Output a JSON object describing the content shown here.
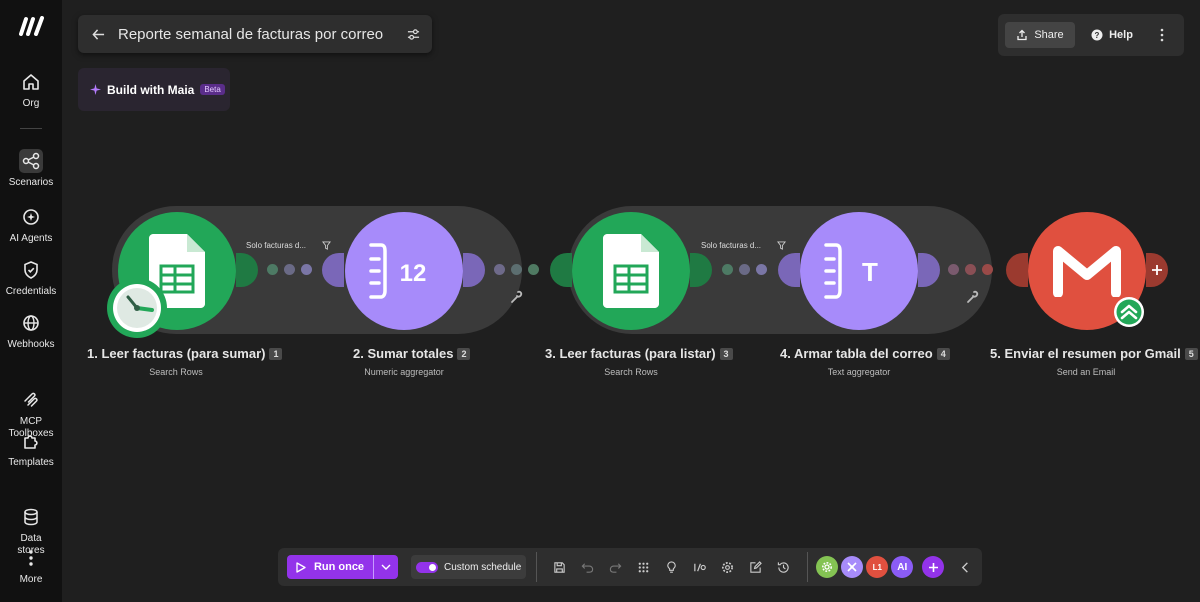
{
  "sidebar": {
    "items": [
      {
        "label": "Org",
        "icon": "home-icon"
      },
      {
        "label": "Scenarios",
        "icon": "scenarios-icon"
      },
      {
        "label": "AI Agents",
        "icon": "ai-agents-icon"
      },
      {
        "label": "Credentials",
        "icon": "shield-icon"
      },
      {
        "label": "Webhooks",
        "icon": "globe-icon"
      },
      {
        "label": "MCP\nToolboxes",
        "icon": "mcp-icon"
      },
      {
        "label": "Templates",
        "icon": "puzzle-icon"
      },
      {
        "label": "Data\nstores",
        "icon": "database-icon"
      },
      {
        "label": "More",
        "icon": "more-vertical-icon"
      }
    ]
  },
  "header": {
    "title": "Reporte semanal de facturas por correo",
    "share_label": "Share",
    "help_label": "Help"
  },
  "maia": {
    "label": "Build with Maia",
    "badge": "Beta"
  },
  "scenario": {
    "filters": [
      "Solo facturas d...",
      "Solo facturas d..."
    ],
    "modules": [
      {
        "label": "1. Leer facturas (para sumar)",
        "number": "1",
        "subtitle": "Search Rows"
      },
      {
        "label": "2. Sumar totales",
        "number": "2",
        "subtitle": "Numeric aggregator"
      },
      {
        "label": "3. Leer facturas (para listar)",
        "number": "3",
        "subtitle": "Search Rows"
      },
      {
        "label": "4. Armar tabla del correo",
        "number": "4",
        "subtitle": "Text aggregator"
      },
      {
        "label": "5. Enviar el resumen por Gmail",
        "number": "5",
        "subtitle": "Send an Email"
      }
    ],
    "icon_texts": {
      "numeric": "12",
      "text": "T"
    }
  },
  "toolbar": {
    "run_label": "Run once",
    "schedule_label": "Custom schedule",
    "badges": [
      "",
      "",
      "L1",
      "AI"
    ]
  },
  "colors": {
    "sheets_green": "#22a758",
    "aggregator_purple": "#a78bfa",
    "gmail_red": "#e0503f",
    "accent_purple": "#9333ea"
  }
}
